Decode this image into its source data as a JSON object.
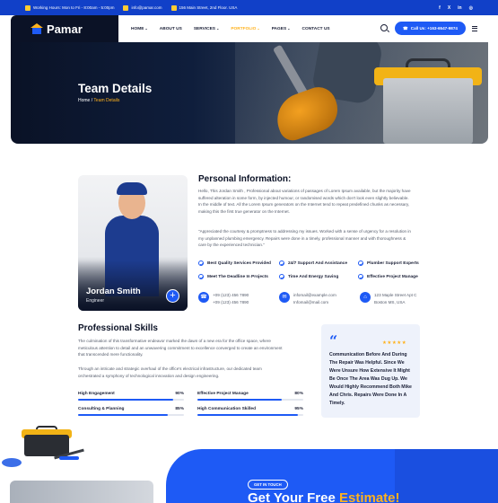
{
  "topbar": {
    "hours": "Working Hours: Mon to Fri - 8:00am - 5:00pm",
    "email": "info@pamar.com",
    "address": "156 Main Street, 2nd Floor. USA",
    "social": [
      "f",
      "X",
      "in",
      "◎"
    ]
  },
  "brand": {
    "name": "Pamar",
    "colors": {
      "primary": "#1e5af5",
      "accent": "#ffb21d",
      "dark": "#0b1226"
    }
  },
  "nav": {
    "items": [
      {
        "label": "HOME",
        "has_dropdown": true
      },
      {
        "label": "ABOUT US",
        "has_dropdown": false
      },
      {
        "label": "SERVICES",
        "has_dropdown": true
      },
      {
        "label": "PORTFOLIO",
        "has_dropdown": true,
        "active": true
      },
      {
        "label": "PAGES",
        "has_dropdown": true
      },
      {
        "label": "CONTACT US",
        "has_dropdown": false
      }
    ],
    "chevron": "⌄",
    "call_label": "Call Us: +163-6547-9874",
    "call_icon": "☎"
  },
  "hero": {
    "title": "Team Details",
    "crumb_home": "Home",
    "crumb_sep": " / ",
    "crumb_current": "Team Details"
  },
  "profile": {
    "name": "Jordan Smith",
    "role": "Engineer",
    "plus": "+"
  },
  "personal": {
    "title": "Personal Information:",
    "p1": "Hello, This Jordan Smith , Professional about variations of passages of Lorem Ipsum available, but the majority have suffered alteration in some form, by injected humour, or randomised words which don't look even slightly believable.\nIn the middle of text. All the Lorem Ipsum generators on the Internet tend to repeat predefined chunks as necessary, making this the first true generator on the Internet.",
    "p2": "\"Appreciated the courtesy & promptness to addressing my issues. Worked with a sense of urgency for a resolution in my unplanned plumbing emergency. Repairs were done in a timely, professional manner and with thoroughness & care by the experienced technician.\"",
    "features": [
      "Best Quality Services Provided",
      "24/7 Support And Assistance",
      "Plumber Support Experts",
      "Meet The Deadline In Projects",
      "Time And Energy Saving",
      "Effective Project Manage"
    ],
    "contacts": [
      {
        "icon": "☎",
        "line1": "+09 (123) 456 7890",
        "line2": "+09 (123) 456 7890"
      },
      {
        "icon": "✉",
        "line1": "infomail@example.com",
        "line2": "Infomail@mail.com"
      },
      {
        "icon": "⌂",
        "line1": "123 Maple Street Apt C",
        "line2": "Boston MS, USA"
      }
    ]
  },
  "skills": {
    "title": "Professional Skills",
    "p1": "The culmination of this transformative endeavor marked the dawn of a new era for the office space, where meticulous attention to detail and an unwavering commitment to excellence converged to create an environment that transcended mere functionality.",
    "p2": "Through an intricate and strategic overhaul of the office's electrical infrastructure, our dedicated team orchestrated a symphony of technological innovation and design engineering.",
    "bars": [
      {
        "label": "High Engagement",
        "value_text": "90%",
        "value": 0.9
      },
      {
        "label": "Effective Project Manage",
        "value_text": "80%",
        "value": 0.8
      },
      {
        "label": "Consulting & Planning",
        "value_text": "85%",
        "value": 0.85
      },
      {
        "label": "High Communication Skilled",
        "value_text": "95%",
        "value": 0.95
      }
    ]
  },
  "testimonial": {
    "quote_mark": "“",
    "stars": "★★★★★",
    "text": "Communication Before And During The Repair Was Helpful. Since We Were Unsure How Extensive It Might Be Once The Area Was Dug Up. We Would Highly Recommend Both Mike And Chris. Repairs Were Done In A Timely."
  },
  "cta": {
    "badge": "GET IN TOUCH",
    "title_a": "Get Your Free ",
    "title_b": "Estimate!"
  }
}
